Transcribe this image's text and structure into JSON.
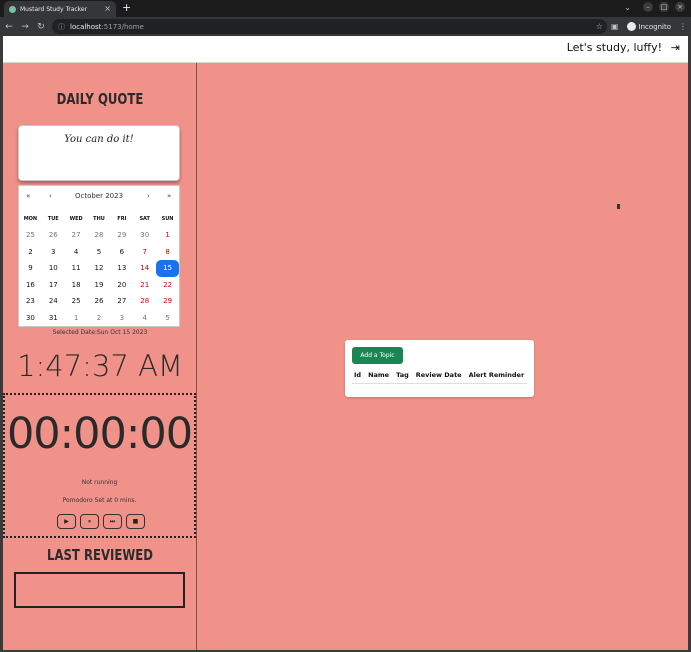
{
  "browser": {
    "tab_title": "Mustard Study Tracker",
    "tab_close": "×",
    "new_tab": "+",
    "url_host": "localhost",
    "url_rest": ":5173/home",
    "incognito_label": "Incognito",
    "nav": {
      "back": "←",
      "forward": "→",
      "reload": "↻"
    }
  },
  "header": {
    "greeting": "Let's study, luffy!",
    "logout_icon": "⇥"
  },
  "sidebar": {
    "quote_title": "DAILY QUOTE",
    "quote_text": "You can do it!",
    "calendar": {
      "month_label": "October 2023",
      "prev_year": "«",
      "prev_month": "‹",
      "next_month": "›",
      "next_year": "»",
      "dows": [
        "MON",
        "TUE",
        "WED",
        "THU",
        "FRI",
        "SAT",
        "SUN"
      ],
      "days": [
        {
          "d": "25",
          "muted": true
        },
        {
          "d": "26",
          "muted": true
        },
        {
          "d": "27",
          "muted": true
        },
        {
          "d": "28",
          "muted": true
        },
        {
          "d": "29",
          "muted": true
        },
        {
          "d": "30",
          "muted": true,
          "weekend": true
        },
        {
          "d": "1",
          "weekend": true
        },
        {
          "d": "2"
        },
        {
          "d": "3"
        },
        {
          "d": "4"
        },
        {
          "d": "5"
        },
        {
          "d": "6"
        },
        {
          "d": "7",
          "weekend": true
        },
        {
          "d": "8",
          "weekend": true
        },
        {
          "d": "9"
        },
        {
          "d": "10"
        },
        {
          "d": "11"
        },
        {
          "d": "12"
        },
        {
          "d": "13"
        },
        {
          "d": "14",
          "weekend": true
        },
        {
          "d": "15",
          "active": true
        },
        {
          "d": "16"
        },
        {
          "d": "17"
        },
        {
          "d": "18"
        },
        {
          "d": "19"
        },
        {
          "d": "20"
        },
        {
          "d": "21",
          "weekend": true
        },
        {
          "d": "22",
          "weekend": true
        },
        {
          "d": "23"
        },
        {
          "d": "24"
        },
        {
          "d": "25"
        },
        {
          "d": "26"
        },
        {
          "d": "27"
        },
        {
          "d": "28",
          "weekend": true
        },
        {
          "d": "29",
          "weekend": true
        },
        {
          "d": "30"
        },
        {
          "d": "31"
        },
        {
          "d": "1",
          "muted": true
        },
        {
          "d": "2",
          "muted": true
        },
        {
          "d": "3",
          "muted": true
        },
        {
          "d": "4",
          "muted": true
        },
        {
          "d": "5",
          "muted": true
        }
      ]
    },
    "selected_date": "Selected Date:Sun Oct 15 2023",
    "clock": "1:47:37 AM",
    "timer": "00:00:00",
    "timer_status": "Not running",
    "pomodoro": "Pomodoro Set at 0 mins.",
    "controls": [
      {
        "name": "play-icon",
        "glyph": "▶"
      },
      {
        "name": "pause-icon",
        "glyph": "⏸"
      },
      {
        "name": "skip-icon",
        "glyph": "⏭"
      },
      {
        "name": "stop-icon",
        "glyph": "■"
      }
    ],
    "reviewed_title": "LAST REVIEWED"
  },
  "main": {
    "add_topic_label": "Add a Topic",
    "columns": [
      "Id",
      "Name",
      "Tag",
      "Review Date",
      "Alert Reminder"
    ]
  },
  "colors": {
    "page_bg": "#f0928a",
    "add_button": "#198754",
    "calendar_active": "#1a73e8"
  }
}
